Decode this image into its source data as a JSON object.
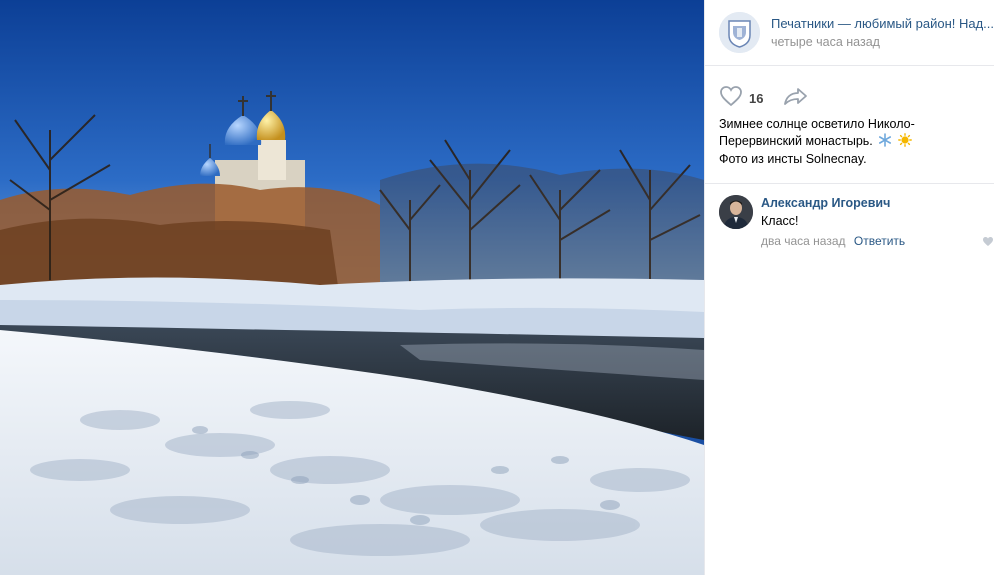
{
  "photo": {
    "description_icon": "photo-image"
  },
  "post": {
    "group_name": "Печатники — любимый район! Над...",
    "time": "четыре часа назад",
    "likes": "16",
    "text_lines": [
      "Зимнее солнце осветило Николо-",
      "Перервинский монастырь.",
      "Фото из инсты Solnecnay."
    ],
    "emojis": [
      "snowflake-icon",
      "sun-icon"
    ]
  },
  "comment": {
    "author": "Александр Игоревич",
    "text": "Класс!",
    "time": "два часа назад",
    "reply_label": "Ответить"
  },
  "colors": {
    "link": "#2a5885",
    "muted": "#939393",
    "divider": "#e7e8ec",
    "icon": "#99a2ad"
  }
}
